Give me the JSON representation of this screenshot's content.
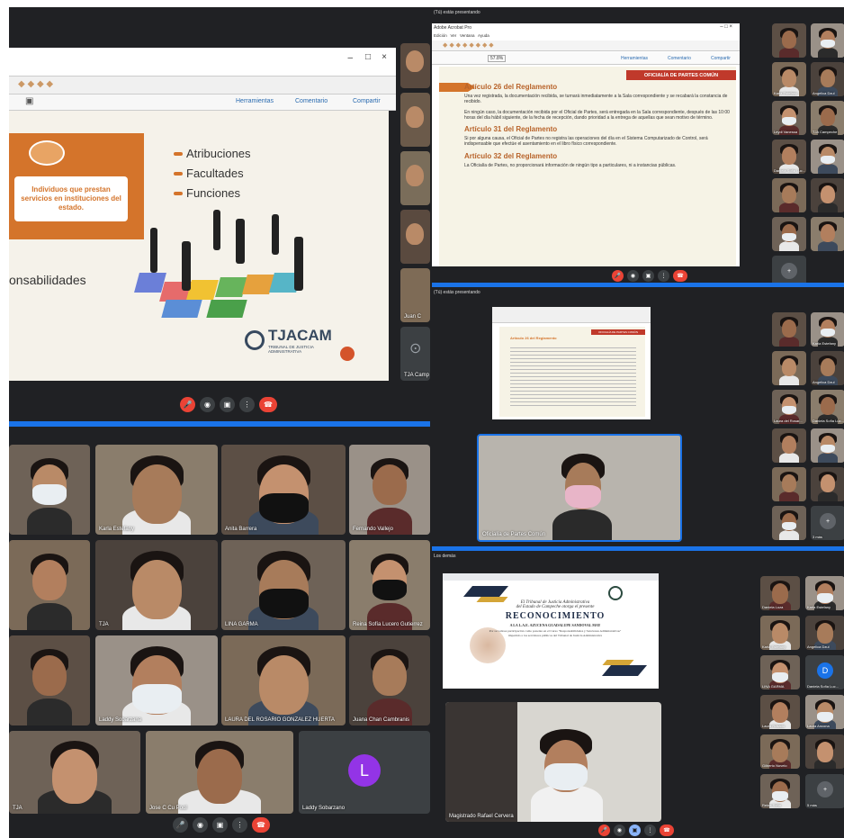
{
  "left_top": {
    "menu_links": [
      "Herramientas",
      "Comentario",
      "Compartir"
    ],
    "bullets": [
      "Atribuciones",
      "Facultades",
      "Funciones"
    ],
    "orange_box_text": "Individuos que prestan servicios en instituciones del estado.",
    "partial_word": "onsabilidades",
    "logo_text": "TJACAM",
    "logo_sub": "TRIBUNAL DE JUSTICIA ADMINISTRATIVA",
    "side_names": [
      "Juan C",
      "TJA Camp"
    ]
  },
  "left_bottom": {
    "tiles": [
      {
        "name": ""
      },
      {
        "name": "Karla Estefany"
      },
      {
        "name": "Anita Barrera"
      },
      {
        "name": "Fernando Vallejo"
      },
      {
        "name": ""
      },
      {
        "name": "TJA"
      },
      {
        "name": "LINA GARMA"
      },
      {
        "name": "Reina Sofía Lucero Gutierrez"
      },
      {
        "name": ""
      },
      {
        "name": "Laddy Sobarzana"
      },
      {
        "name": "LAURA DEL ROSARIO GONZALEZ HUERTA"
      },
      {
        "name": "Juana Chan Cambranis"
      },
      {
        "name": "TJA"
      },
      {
        "name": "Jose C Cu Pool"
      },
      {
        "name": "Laddy Sobarzano"
      }
    ],
    "avatar_letter": "L",
    "avatar_color": "#9334e6"
  },
  "right_top": {
    "header": "(Tú) estás presentando",
    "app_title": "Adobe Acrobat Pro",
    "menu": "Edición   Ver   Ventana   Ayuda",
    "zoom": "57.8%",
    "links": [
      "Herramientas",
      "Comentario",
      "Compartir"
    ],
    "banner": "OFICIALÍA DE PARTES COMÚN",
    "sections": [
      {
        "title": "Artículo 26 del Reglamento",
        "text": "Una vez registrada, la documentación recibida, se turnará inmediatamente a la Sala correspondiente y se recabará la constancia de recibido."
      },
      {
        "title": "",
        "text": "En ningún caso, la documentación recibida por el Oficial de Partes, será entregada en la Sala correspondiente, después de las 10:00 horas del día hábil siguiente, de la fecha de recepción, dando prioridad a la entrega de aquellas que sean motivo de término."
      },
      {
        "title": "Artículo 31 del Reglamento",
        "text": "Si por alguna causa, el Oficial de Partes no registra las operaciones del día en el Sistema Computarizado de Control, será indispensable que efectúe el asentamiento en el libro físico correspondiente."
      },
      {
        "title": "Artículo 32 del Reglamento",
        "text": "La Oficialía de Partes, no proporcionará información de ningún tipo a particulares, ni a instancias públicas."
      }
    ],
    "participants": [
      "",
      "",
      "Karla Estefany",
      "Angelica Dzul",
      "Leydi Vanessa",
      "TJA Campeche",
      "Daniela Sofía Luc...",
      "",
      "",
      "",
      "",
      "",
      "3 más"
    ]
  },
  "right_middle": {
    "header": "(Tú) estás presentando",
    "mini_title": "Artículo 26 del Reglamento",
    "mini_banner": "OFICIALÍA DE PARTES COMÚN",
    "presenter_name": "Oficialía de Partes Común",
    "participants": [
      "",
      "Karla Estefany",
      "",
      "Angelica Dzul",
      "Laura del Rosar...",
      "Daniela Sofía Luc...",
      "",
      "",
      "",
      "",
      "",
      "3 más"
    ]
  },
  "right_bottom": {
    "header": "Los demás",
    "certificate": {
      "line1": "El Tribunal de Justicia Administrativa",
      "line2": "del Estado de Campeche otorga el presente",
      "title": "RECONOCIMIENTO",
      "recipient": "A LA L.A.E. AZUCENA GUADALUPE SANDOVAL MAY",
      "body": "Por su valiosa participación como ponente en el Curso \"Responsabilidades y Sanciones Administrativas\" impartido a los servidores públicos del Tribunal de Justicia Administrativa"
    },
    "presenter_name": "Magistrado Rafael Cervera",
    "avatar_letter": "D",
    "avatar_color": "#1a73e8",
    "participants": [
      "Daniela Loza",
      "Karla Estefany",
      "Karla Estefany",
      "Angelica Dzul",
      "LINA GARMA",
      "Daniela Sofía Luc...",
      "Laura Rosado",
      "Laura Ancona",
      "Gilberto Novelo",
      "",
      "Reina Sofía",
      "5 más"
    ]
  }
}
